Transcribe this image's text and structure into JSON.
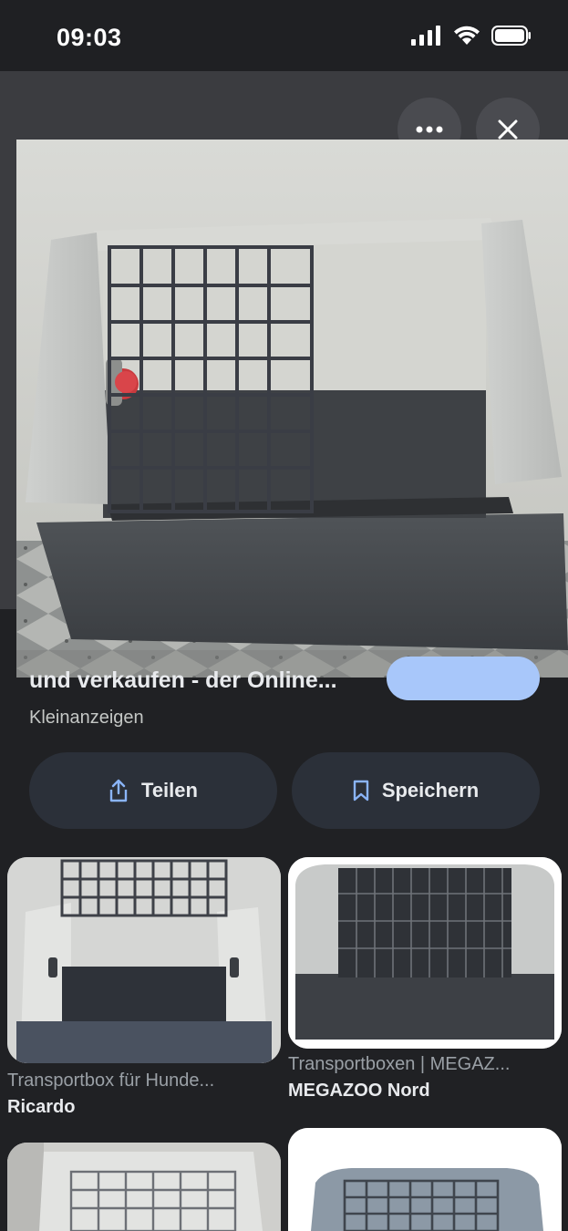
{
  "status_bar": {
    "time": "09:03"
  },
  "viewer": {
    "more_icon": "more-horizontal-icon",
    "close_icon": "close-icon",
    "result_title": "und verkaufen - der Online...",
    "source": "Kleinanzeigen",
    "share_label": "Teilen",
    "save_label": "Speichern"
  },
  "related": [
    {
      "caption": "Transportbox für Hunde...",
      "source": "Ricardo"
    },
    {
      "caption": "Transportboxen | MEGAZ...",
      "source": "MEGAZOO Nord"
    },
    {
      "caption": "",
      "source": ""
    },
    {
      "caption": "",
      "source": ""
    }
  ],
  "colors": {
    "background": "#202124",
    "button_bg": "#2b3039",
    "accent_pill": "#a8c7fa"
  }
}
